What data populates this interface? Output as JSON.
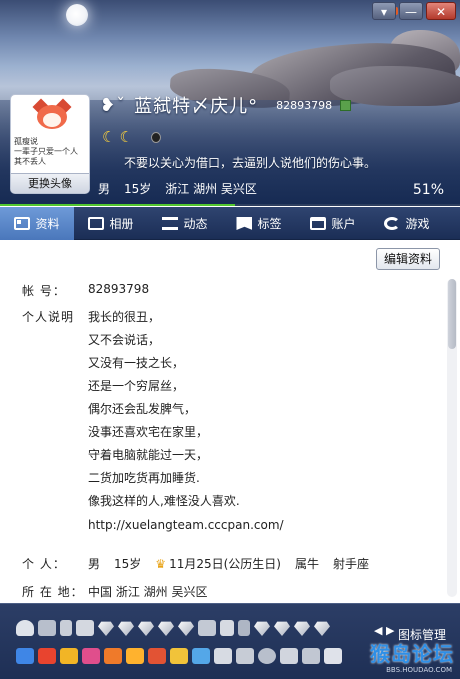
{
  "window": {
    "buttons": [
      "▾",
      "—",
      "✕"
    ]
  },
  "profile": {
    "nickname": "蓝弑特〆庆儿°",
    "prefix_glyph": "❥ˇ",
    "qq_number": "82893798",
    "avatar_caption": "孤瘦说\n一辈子只爱一个人\n其不丢人",
    "change_avatar": "更换头像",
    "signature": "不要以关心为借口，去逼别人说他们的伤心事。",
    "gender": "男",
    "age": "15岁",
    "location": "浙江  湖州  吴兴区",
    "completion": "51%",
    "completion_value": 0.51
  },
  "tabs": [
    {
      "label": "资料",
      "icon": "profile-card-icon",
      "active": true
    },
    {
      "label": "相册",
      "icon": "album-icon"
    },
    {
      "label": "动态",
      "icon": "feed-icon"
    },
    {
      "label": "标签",
      "icon": "tag-icon"
    },
    {
      "label": "账户",
      "icon": "wallet-icon"
    },
    {
      "label": "游戏",
      "icon": "game-icon"
    }
  ],
  "details": {
    "edit_button": "编辑资料",
    "account_label": "帐    号：",
    "account_value": "82893798",
    "desc_label": "个人说明",
    "desc_lines": [
      "我长的很丑，",
      "又不会说话，",
      "又没有一技之长，",
      "还是一个穷屌丝，",
      "偶尔还会乱发脾气，",
      "没事还喜欢宅在家里，",
      "守着电脑就能过一天，",
      "二货加吃货再加睡货.",
      "像我这样的人,难怪没人喜欢.",
      "",
      "http://xuelangteam.cccpan.com/"
    ],
    "personal_label": "个    人：",
    "personal_gender": "男",
    "personal_age": "15岁",
    "birthday": "11月25日(公历生日)",
    "zodiac": "属牛",
    "constellation": "射手座",
    "location_label": "所 在 地：",
    "location_value": "中国  浙江  湖州  吴兴区"
  },
  "iconbar": {
    "manage_label": "图标管理",
    "arrows": "◀ ▶",
    "watermark": "猴岛论坛",
    "watermark_sub": "BBS.HOUDAO.COM"
  },
  "colors": {
    "header_dark": "#203660",
    "tab_active": "#5a87c9",
    "progress": "#52c82f",
    "watermark": "#2f8fe6"
  }
}
